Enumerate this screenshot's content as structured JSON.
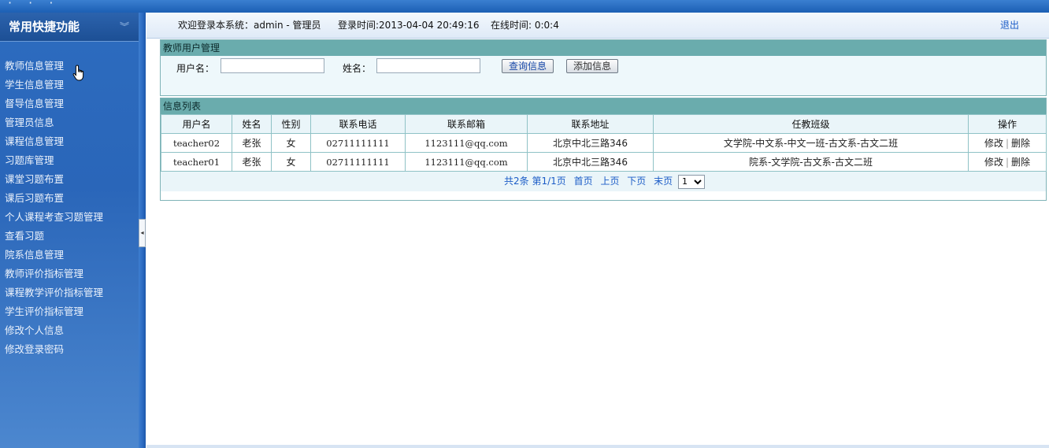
{
  "sidebar": {
    "title": "常用快捷功能",
    "items": [
      {
        "label": "教师信息管理"
      },
      {
        "label": "学生信息管理"
      },
      {
        "label": "督导信息管理"
      },
      {
        "label": "管理员信息"
      },
      {
        "label": "课程信息管理"
      },
      {
        "label": "习题库管理"
      },
      {
        "label": "课堂习题布置"
      },
      {
        "label": "课后习题布置"
      },
      {
        "label": "个人课程考查习题管理"
      },
      {
        "label": "查看习题"
      },
      {
        "label": "院系信息管理"
      },
      {
        "label": "教师评价指标管理"
      },
      {
        "label": "课程教学评价指标管理"
      },
      {
        "label": "学生评价指标管理"
      },
      {
        "label": "修改个人信息"
      },
      {
        "label": "修改登录密码"
      }
    ]
  },
  "infobar": {
    "welcome": "欢迎登录本系统：admin - 管理员",
    "login_time": "登录时间:2013-04-04 20:49:16",
    "online_time": "在线时间: 0:0:4",
    "logout": "退出"
  },
  "search": {
    "title": "教师用户管理",
    "username_label": "用户名：",
    "username_value": "",
    "name_label": "姓名：",
    "name_value": "",
    "query_button": "查询信息",
    "add_button": "添加信息"
  },
  "list": {
    "title": "信息列表",
    "columns": [
      "用户名",
      "姓名",
      "性别",
      "联系电话",
      "联系邮箱",
      "联系地址",
      "任教班级",
      "操作"
    ],
    "rows": [
      {
        "username": "teacher02",
        "name": "老张",
        "gender": "女",
        "phone": "02711111111",
        "email": "1123111@qq.com",
        "address": "北京中北三路346",
        "classes": "文学院-中文系-中文一班-古文系-古文二班",
        "edit": "修改",
        "delete": "删除"
      },
      {
        "username": "teacher01",
        "name": "老张",
        "gender": "女",
        "phone": "02711111111",
        "email": "1123111@qq.com",
        "address": "北京中北三路346",
        "classes": "院系-文学院-古文系-古文二班",
        "edit": "修改",
        "delete": "删除"
      }
    ],
    "pager": {
      "summary": "共2条 第1/1页",
      "first": "首页",
      "prev": "上页",
      "next": "下页",
      "last": "末页",
      "page_select": "1"
    }
  },
  "colors": {
    "sidebar_bg": "#2a66b9",
    "panel_header": "#6aacad",
    "link_blue": "#1b5cc7"
  }
}
